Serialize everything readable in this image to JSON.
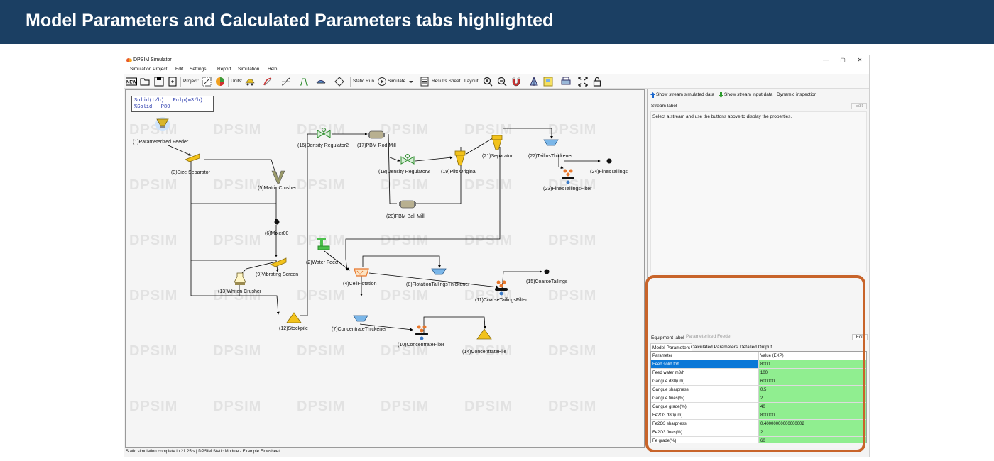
{
  "banner": {
    "title": "Model Parameters and Calculated Parameters tabs highlighted"
  },
  "window": {
    "title": "DPSIM Simulator",
    "controls": {
      "minimize": "—",
      "maximize": "▢",
      "close": "✕"
    }
  },
  "menu": [
    "Simulation Project",
    "Edit",
    "Settings...",
    "Report",
    "Simulation",
    "Help"
  ],
  "toolbar": {
    "new": "NEW",
    "project": "Project:",
    "units": "Units:",
    "static_run": "Static Run",
    "simulate": "Simulate",
    "results_sheet": "Results Sheet",
    "layout": "Layout:"
  },
  "canvas": {
    "legend": {
      "line1": "Solid(t/h)   Pulp(m3/h)",
      "line2": "%Solid   P80"
    },
    "watermark": "DPSIM",
    "nodes": {
      "n1": "(1)Parameterized Feeder",
      "n2": "(2)Water Feed",
      "n3": "(3)Size Separator",
      "n4": "(4)CellFlotation",
      "n5": "(5)Matrix Crusher",
      "n6": "(6)Mixer00",
      "n7": "(7)ConcentrateThickener",
      "n8": "(8)FlotationTailingsThickener",
      "n9": "(9)Vibrating Screen",
      "n10": "(10)ConcentrateFilter",
      "n11": "(11)CoarseTailingsFilter",
      "n12": "(12)Stockpile",
      "n13": "(13)Whiten Crusher",
      "n14": "(14)ConcentratePile",
      "n15": "(15)CoarseTailings",
      "n16": "(16)Density Regulator2",
      "n17": "(17)PBM Rod Mill",
      "n18": "(18)Density Regulator3",
      "n19": "(19)Plitt Original",
      "n20": "(20)PBM Ball Mill",
      "n21": "(21)Separator",
      "n22": "(22)TailinsThickener",
      "n23": "(23)FinesTailingsFilter",
      "n24": "(24)FinesTailings"
    }
  },
  "right_panel": {
    "show_simulated": "Show stream simulated data",
    "show_input": "Show stream input data",
    "dynamic_inspection": "Dynamic inspection",
    "stream_label": "Stream label",
    "edit": "Edit",
    "hint": "Select a stream and use the buttons above to display the properties."
  },
  "equipment_panel": {
    "label": "Equipment label",
    "value": "Parameterized Feeder",
    "edit": "Edit",
    "tabs": [
      "Model Parameters",
      "Calculated Parameters",
      "Detailed Output"
    ],
    "columns": [
      "Parameter",
      "Value (EXP)"
    ],
    "rows": [
      [
        "Feed solid tph",
        "8000"
      ],
      [
        "Feed water m3/h",
        "100"
      ],
      [
        "Gangue d80(um)",
        "600000"
      ],
      [
        "Gangue sharpness",
        "0.5"
      ],
      [
        "Gangue fines(%)",
        "2"
      ],
      [
        "Gangue grade(%)",
        "40"
      ],
      [
        "Fe2O3 d80(um)",
        "800000"
      ],
      [
        "Fe2O3 sharpness",
        "0.40000000000000002"
      ],
      [
        "Fe2O3 fines(%)",
        "2"
      ],
      [
        "Fe grade(%)",
        "60"
      ]
    ]
  },
  "status": {
    "text": "Static simulation complete in 21.25 s  |  DPSIM Static Module - Example Flowsheet"
  },
  "colors": {
    "banner": "#1b3f63",
    "highlight": "#c8642a",
    "value_cell": "#90ee90",
    "selected_row": "#0b78d7",
    "equipment_gold": "#f2c21b"
  }
}
